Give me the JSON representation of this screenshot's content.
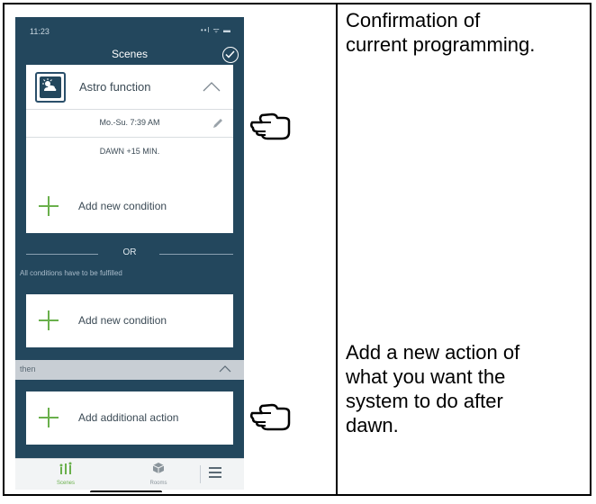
{
  "status": {
    "time": "11:23",
    "signal": "••l ᯤ ▬"
  },
  "header": {
    "title": "Scenes",
    "confirm_icon": "check-circle-icon"
  },
  "astro": {
    "icon": "sun-cloud-icon",
    "label": "Astro function",
    "schedule": "Mo.-Su. 7:39 AM",
    "offset": "DAWN +15 MIN."
  },
  "conditions": [
    {
      "label": "Add new condition"
    },
    {
      "label": "Add new condition"
    }
  ],
  "separator": {
    "or": "OR",
    "note": "All conditions have to be fulfilled"
  },
  "then": {
    "label": "then"
  },
  "action": {
    "label": "Add additional action"
  },
  "tabbar": {
    "scenes": "Scenes",
    "rooms": "Rooms"
  },
  "annotations": {
    "note1": "Confirmation of\ncurrent programming.",
    "note2": "Add a new action of\nwhat you want the\nsystem to do after\ndawn."
  },
  "colors": {
    "background": "#23475d",
    "accent": "#6ab04c",
    "card": "#ffffff"
  }
}
